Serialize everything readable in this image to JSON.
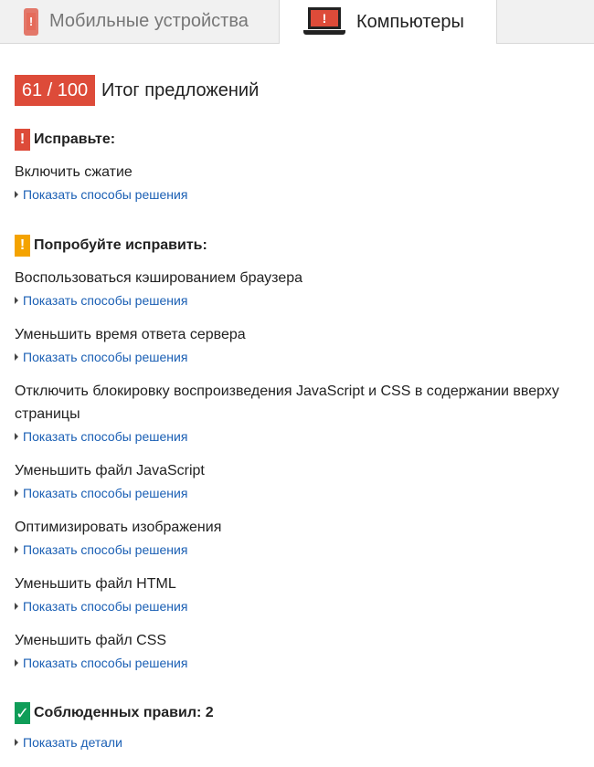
{
  "tabs": {
    "mobile_label": "Мобильные устройства",
    "desktop_label": "Компьютеры",
    "active": "desktop"
  },
  "summary": {
    "score": "61 / 100",
    "title": "Итог предложений"
  },
  "sections": {
    "fix": {
      "heading": "Исправьте:",
      "badge": "!",
      "rules": [
        {
          "title": "Включить сжатие",
          "link": "Показать способы решения"
        }
      ]
    },
    "consider": {
      "heading": "Попробуйте исправить:",
      "badge": "!",
      "rules": [
        {
          "title": "Воспользоваться кэшированием браузера",
          "link": "Показать способы решения"
        },
        {
          "title": "Уменьшить время ответа сервера",
          "link": "Показать способы решения"
        },
        {
          "title": "Отключить блокировку воспроизведения JavaScript и CSS в содержании вверху страницы",
          "link": "Показать способы решения"
        },
        {
          "title": "Уменьшить файл JavaScript",
          "link": "Показать способы решения"
        },
        {
          "title": "Оптимизировать изображения",
          "link": "Показать способы решения"
        },
        {
          "title": "Уменьшить файл HTML",
          "link": "Показать способы решения"
        },
        {
          "title": "Уменьшить файл CSS",
          "link": "Показать способы решения"
        }
      ]
    },
    "passed": {
      "heading": "Соблюденных правил: 2",
      "badge": "✓",
      "link": "Показать детали"
    }
  },
  "colors": {
    "error": "#dd4b39",
    "warning": "#f4a300",
    "success": "#0f9d58",
    "link": "#1a5fb4"
  },
  "icons": {
    "mobile_tab": "mobile-phone-alert-icon",
    "desktop_tab": "laptop-alert-icon",
    "fix": "exclamation-icon",
    "consider": "exclamation-icon",
    "passed": "checkmark-icon",
    "expand": "triangle-right-icon"
  }
}
